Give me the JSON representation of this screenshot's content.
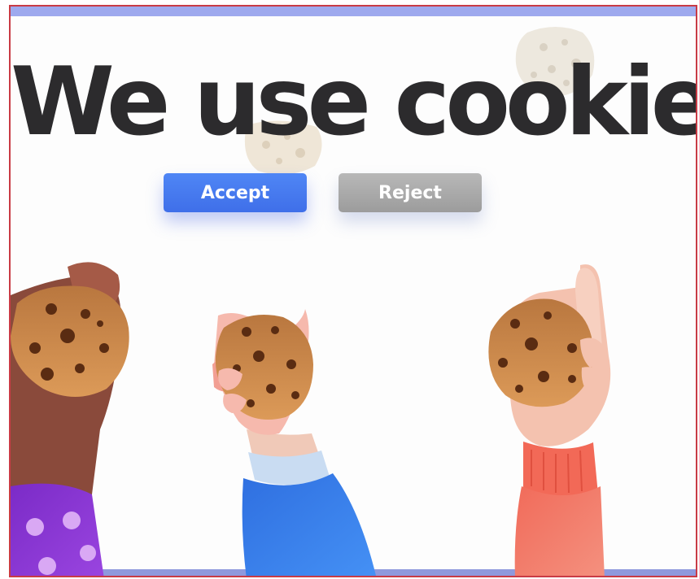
{
  "banner": {
    "headline": "We use cookies",
    "accept_label": "Accept",
    "reject_label": "Reject"
  },
  "colors": {
    "accept": "#4a7ef2",
    "reject": "#a9a9a9",
    "headline": "#2c2b2d",
    "frame_border": "#c93b45",
    "top_bar": "#9ea9ee"
  },
  "icons": [
    "cookie-icon",
    "hand-holding-cookie-icon"
  ]
}
